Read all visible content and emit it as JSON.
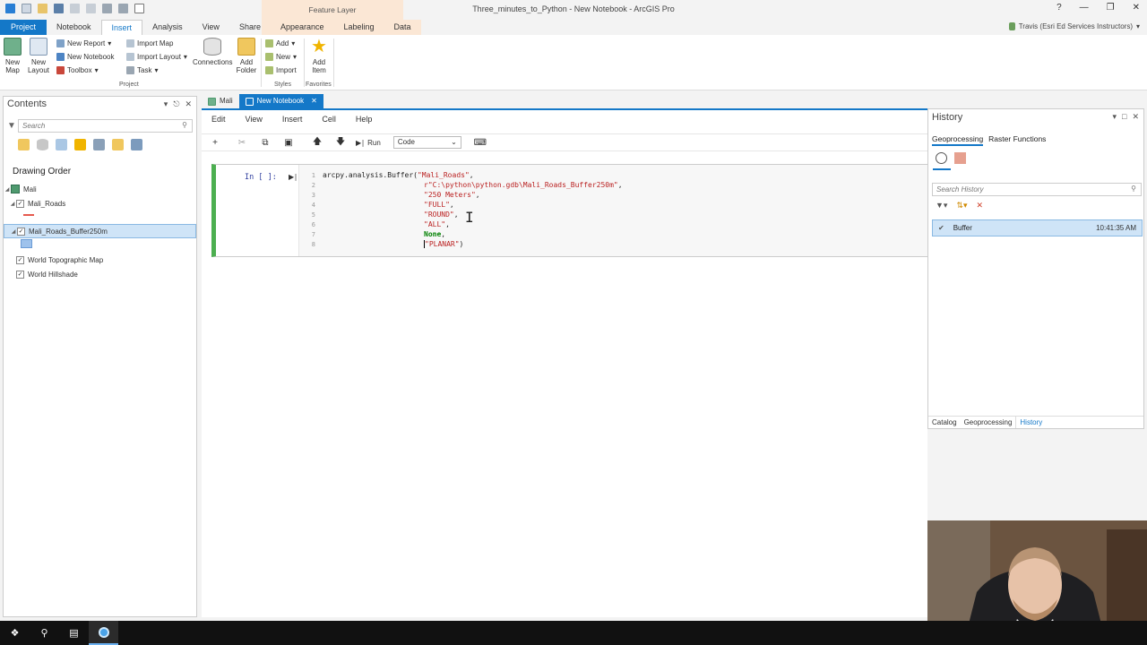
{
  "window": {
    "title": "Three_minutes_to_Python - New Notebook - ArcGIS Pro",
    "context_tab": "Feature Layer",
    "help": "?",
    "user": "Travis (Esri Ed Services Instructors)"
  },
  "ribbon_tabs": [
    "Project",
    "Notebook",
    "Insert",
    "Analysis",
    "View",
    "Share",
    "Appearance",
    "Labeling",
    "Data"
  ],
  "ribbon": {
    "new_map": "New\nMap",
    "new_layout": "New\nLayout",
    "new_report": "New Report",
    "new_notebook": "New Notebook",
    "toolbox": "Toolbox",
    "import_map": "Import Map",
    "import_layout": "Import Layout",
    "task": "Task",
    "connections": "Connections",
    "add_folder": "Add\nFolder",
    "group_project": "Project",
    "styles_add": "Add",
    "styles_new": "New",
    "styles_import": "Import",
    "group_styles": "Styles",
    "add_item": "Add\nItem",
    "group_favorites": "Favorites"
  },
  "contents": {
    "title": "Contents",
    "search_placeholder": "Search",
    "drawing_order": "Drawing Order",
    "map": "Mali",
    "layers": [
      "Mali_Roads",
      "Mali_Roads_Buffer250m",
      "World Topographic Map",
      "World Hillshade"
    ]
  },
  "doc_tabs": [
    "Mali",
    "New Notebook"
  ],
  "notebook": {
    "menu": [
      "Edit",
      "View",
      "Insert",
      "Cell",
      "Help"
    ],
    "run_label": "Run",
    "cell_type": "Code",
    "prompt": "In [ ]:",
    "line_numbers": [
      "1",
      "2",
      "3",
      "4",
      "5",
      "6",
      "7",
      "8"
    ],
    "code": {
      "l1_fn": "arcpy.analysis.Buffer(",
      "l1_str": "\"Mali_Roads\"",
      "l1_end": ",",
      "l2": "r\"C:\\python\\python.gdb\\Mali_Roads_Buffer250m\"",
      "l2_end": ",",
      "l3": "\"250 Meters\"",
      "l4": "\"FULL\"",
      "l5": "\"ROUND\"",
      "l6": "\"ALL\"",
      "l7": "None",
      "l8": "\"PLANAR\"",
      "l8_end": ")",
      "comma": ","
    }
  },
  "history": {
    "title": "History",
    "tabs": [
      "Geoprocessing",
      "Raster Functions"
    ],
    "search_placeholder": "Search History",
    "entry_name": "Buffer",
    "entry_time": "10:41:35 AM",
    "bottom_tabs": [
      "Catalog",
      "Geoprocessing",
      "History"
    ]
  },
  "colors": {
    "accent": "#1478c8",
    "cell_active": "#4caf50",
    "string": "#ba2121",
    "keyword": "#008000"
  }
}
